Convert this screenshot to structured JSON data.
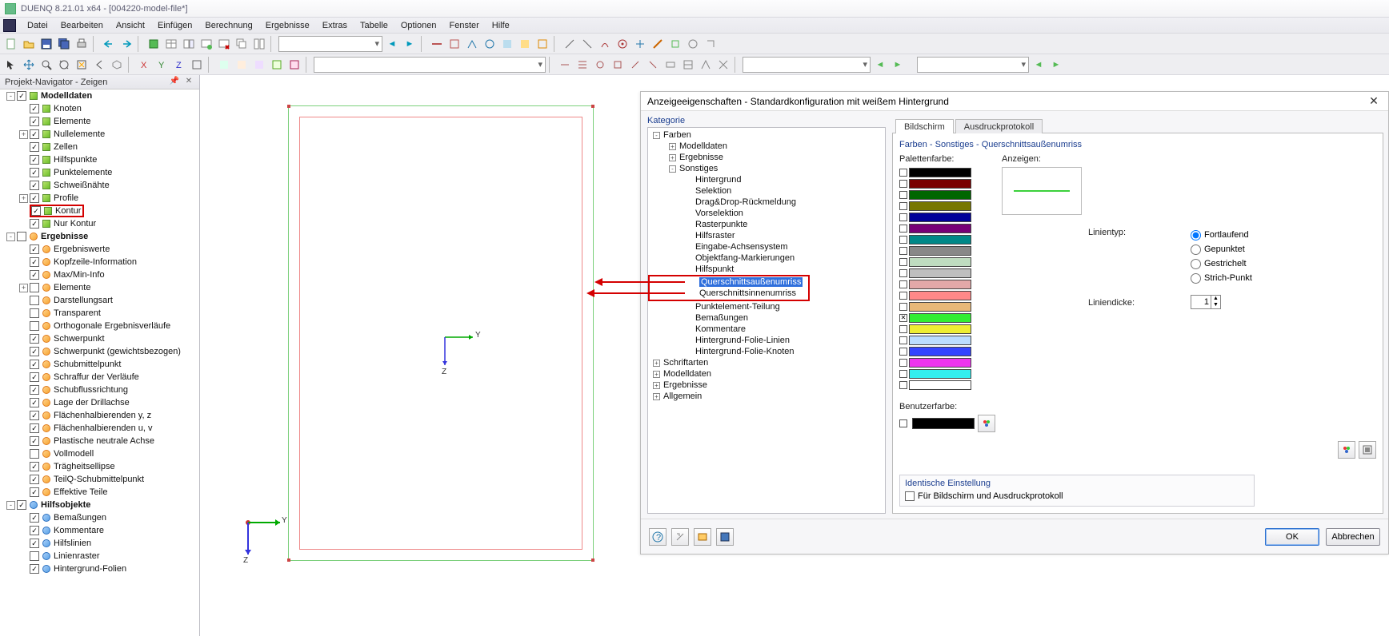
{
  "title": "DUENQ 8.21.01 x64 - [004220-model-file*]",
  "menu": [
    "Datei",
    "Bearbeiten",
    "Ansicht",
    "Einfügen",
    "Berechnung",
    "Ergebnisse",
    "Extras",
    "Tabelle",
    "Optionen",
    "Fenster",
    "Hilfe"
  ],
  "navigator": {
    "title": "Projekt-Navigator - Zeigen",
    "items": [
      {
        "indent": 0,
        "exp": "-",
        "chk": "on",
        "icon": "sq",
        "label": "Modelldaten",
        "bold": true
      },
      {
        "indent": 1,
        "exp": "",
        "chk": "on",
        "icon": "sq",
        "label": "Knoten"
      },
      {
        "indent": 1,
        "exp": "",
        "chk": "on",
        "icon": "sq",
        "label": "Elemente"
      },
      {
        "indent": 1,
        "exp": "+",
        "chk": "on",
        "icon": "sq",
        "label": "Nullelemente"
      },
      {
        "indent": 1,
        "exp": "",
        "chk": "on",
        "icon": "sq",
        "label": "Zellen"
      },
      {
        "indent": 1,
        "exp": "",
        "chk": "on",
        "icon": "sq",
        "label": "Hilfspunkte"
      },
      {
        "indent": 1,
        "exp": "",
        "chk": "on",
        "icon": "sq",
        "label": "Punktelemente"
      },
      {
        "indent": 1,
        "exp": "",
        "chk": "on",
        "icon": "sq",
        "label": "Schweißnähte"
      },
      {
        "indent": 1,
        "exp": "+",
        "chk": "on",
        "icon": "sq",
        "label": "Profile"
      },
      {
        "indent": 1,
        "exp": "",
        "chk": "on",
        "icon": "sq",
        "label": "Kontur",
        "red": true
      },
      {
        "indent": 1,
        "exp": "",
        "chk": "on",
        "icon": "sq",
        "label": "Nur Kontur"
      },
      {
        "indent": 0,
        "exp": "-",
        "chk": "off",
        "icon": "crc",
        "label": "Ergebnisse",
        "bold": true
      },
      {
        "indent": 1,
        "exp": "",
        "chk": "on",
        "icon": "crc",
        "label": "Ergebniswerte"
      },
      {
        "indent": 1,
        "exp": "",
        "chk": "on",
        "icon": "crc",
        "label": "Kopfzeile-Information"
      },
      {
        "indent": 1,
        "exp": "",
        "chk": "on",
        "icon": "crc",
        "label": "Max/Min-Info"
      },
      {
        "indent": 1,
        "exp": "+",
        "chk": "off",
        "icon": "crc",
        "label": "Elemente"
      },
      {
        "indent": 1,
        "exp": "",
        "chk": "off",
        "icon": "crc",
        "label": "Darstellungsart"
      },
      {
        "indent": 1,
        "exp": "",
        "chk": "off",
        "icon": "crc",
        "label": "Transparent"
      },
      {
        "indent": 1,
        "exp": "",
        "chk": "off",
        "icon": "crc",
        "label": "Orthogonale Ergebnisverläufe"
      },
      {
        "indent": 1,
        "exp": "",
        "chk": "on",
        "icon": "crc",
        "label": "Schwerpunkt"
      },
      {
        "indent": 1,
        "exp": "",
        "chk": "on",
        "icon": "crc",
        "label": "Schwerpunkt (gewichtsbezogen)"
      },
      {
        "indent": 1,
        "exp": "",
        "chk": "on",
        "icon": "crc",
        "label": "Schubmittelpunkt"
      },
      {
        "indent": 1,
        "exp": "",
        "chk": "on",
        "icon": "crc",
        "label": "Schraffur der Verläufe"
      },
      {
        "indent": 1,
        "exp": "",
        "chk": "on",
        "icon": "crc",
        "label": "Schubflussrichtung"
      },
      {
        "indent": 1,
        "exp": "",
        "chk": "on",
        "icon": "crc",
        "label": "Lage der Drillachse"
      },
      {
        "indent": 1,
        "exp": "",
        "chk": "on",
        "icon": "crc",
        "label": "Flächenhalbierenden y, z"
      },
      {
        "indent": 1,
        "exp": "",
        "chk": "on",
        "icon": "crc",
        "label": "Flächenhalbierenden u, v"
      },
      {
        "indent": 1,
        "exp": "",
        "chk": "on",
        "icon": "crc",
        "label": "Plastische neutrale Achse"
      },
      {
        "indent": 1,
        "exp": "",
        "chk": "off",
        "icon": "crc",
        "label": "Vollmodell"
      },
      {
        "indent": 1,
        "exp": "",
        "chk": "on",
        "icon": "crc",
        "label": "Trägheitsellipse"
      },
      {
        "indent": 1,
        "exp": "",
        "chk": "on",
        "icon": "crc",
        "label": "TeilQ-Schubmittelpunkt"
      },
      {
        "indent": 1,
        "exp": "",
        "chk": "on",
        "icon": "crc",
        "label": "Effektive Teile"
      },
      {
        "indent": 0,
        "exp": "-",
        "chk": "on",
        "icon": "blue",
        "label": "Hilfsobjekte",
        "bold": true
      },
      {
        "indent": 1,
        "exp": "",
        "chk": "on",
        "icon": "blue",
        "label": "Bemaßungen"
      },
      {
        "indent": 1,
        "exp": "",
        "chk": "on",
        "icon": "blue",
        "label": "Kommentare"
      },
      {
        "indent": 1,
        "exp": "",
        "chk": "on",
        "icon": "blue",
        "label": "Hilfslinien"
      },
      {
        "indent": 1,
        "exp": "",
        "chk": "off",
        "icon": "blue",
        "label": "Linienraster"
      },
      {
        "indent": 1,
        "exp": "",
        "chk": "on",
        "icon": "blue",
        "label": "Hintergrund-Folien"
      }
    ]
  },
  "canvas": {
    "axisY": "Y",
    "axisZ": "Z",
    "axisY2": "Y",
    "axisZ2": "Z"
  },
  "dialog": {
    "title": "Anzeigeeigenschaften - Standardkonfiguration mit weißem Hintergrund",
    "category_label": "Kategorie",
    "cat_tree": [
      {
        "indent": 0,
        "exp": "-",
        "label": "Farben"
      },
      {
        "indent": 1,
        "exp": "+",
        "label": "Modelldaten"
      },
      {
        "indent": 1,
        "exp": "+",
        "label": "Ergebnisse"
      },
      {
        "indent": 1,
        "exp": "-",
        "label": "Sonstiges"
      },
      {
        "indent": 2,
        "exp": "",
        "label": "Hintergrund"
      },
      {
        "indent": 2,
        "exp": "",
        "label": "Selektion"
      },
      {
        "indent": 2,
        "exp": "",
        "label": "Drag&Drop-Rückmeldung"
      },
      {
        "indent": 2,
        "exp": "",
        "label": "Vorselektion"
      },
      {
        "indent": 2,
        "exp": "",
        "label": "Rasterpunkte"
      },
      {
        "indent": 2,
        "exp": "",
        "label": "Hilfsraster"
      },
      {
        "indent": 2,
        "exp": "",
        "label": "Eingabe-Achsensystem"
      },
      {
        "indent": 2,
        "exp": "",
        "label": "Objektfang-Markierungen"
      },
      {
        "indent": 2,
        "exp": "",
        "label": "Hilfspunkt"
      },
      {
        "indent": 2,
        "exp": "",
        "label": "Querschnittsaußenumriss",
        "sel": true,
        "red_start": true
      },
      {
        "indent": 2,
        "exp": "",
        "label": "Querschnittsinnenumriss",
        "red_end": true
      },
      {
        "indent": 2,
        "exp": "",
        "label": "Punktelement-Teilung"
      },
      {
        "indent": 2,
        "exp": "",
        "label": "Bemaßungen"
      },
      {
        "indent": 2,
        "exp": "",
        "label": "Kommentare"
      },
      {
        "indent": 2,
        "exp": "",
        "label": "Hintergrund-Folie-Linien"
      },
      {
        "indent": 2,
        "exp": "",
        "label": "Hintergrund-Folie-Knoten"
      },
      {
        "indent": 0,
        "exp": "+",
        "label": "Schriftarten"
      },
      {
        "indent": 0,
        "exp": "+",
        "label": "Modelldaten"
      },
      {
        "indent": 0,
        "exp": "+",
        "label": "Ergebnisse"
      },
      {
        "indent": 0,
        "exp": "+",
        "label": "Allgemein"
      }
    ],
    "tabs": {
      "active": "Bildschirm",
      "other": "Ausdruckprotokoll"
    },
    "section": "Farben - Sonstiges - Querschnittsaußenumriss",
    "labels": {
      "palette": "Palettenfarbe:",
      "show": "Anzeigen:",
      "linetype": "Linientyp:",
      "thickness": "Liniendicke:",
      "userclr": "Benutzerfarbe:"
    },
    "swatches": [
      {
        "c": "#000000"
      },
      {
        "c": "#7a0000"
      },
      {
        "c": "#006600"
      },
      {
        "c": "#777700"
      },
      {
        "c": "#000099"
      },
      {
        "c": "#770077"
      },
      {
        "c": "#008888"
      },
      {
        "c": "#888888"
      },
      {
        "c": "#bfdcc0"
      },
      {
        "c": "#bfbfbf"
      },
      {
        "c": "#e3a8a8"
      },
      {
        "c": "#ff8888"
      },
      {
        "c": "#e8b878"
      },
      {
        "c": "#33ee33",
        "on": true
      },
      {
        "c": "#eeee33"
      },
      {
        "c": "#bbddff"
      },
      {
        "c": "#3344ff"
      },
      {
        "c": "#ee33ee"
      },
      {
        "c": "#33eeee"
      },
      {
        "c": "#ffffff"
      }
    ],
    "linetypes": [
      "Fortlaufend",
      "Gepunktet",
      "Gestrichelt",
      "Strich-Punkt"
    ],
    "linetype_selected": 0,
    "thickness_value": "1",
    "ident": {
      "hdr": "Identische Einstellung",
      "chk": "Für Bildschirm und Ausdruckprotokoll"
    },
    "buttons": {
      "ok": "OK",
      "cancel": "Abbrechen"
    }
  }
}
